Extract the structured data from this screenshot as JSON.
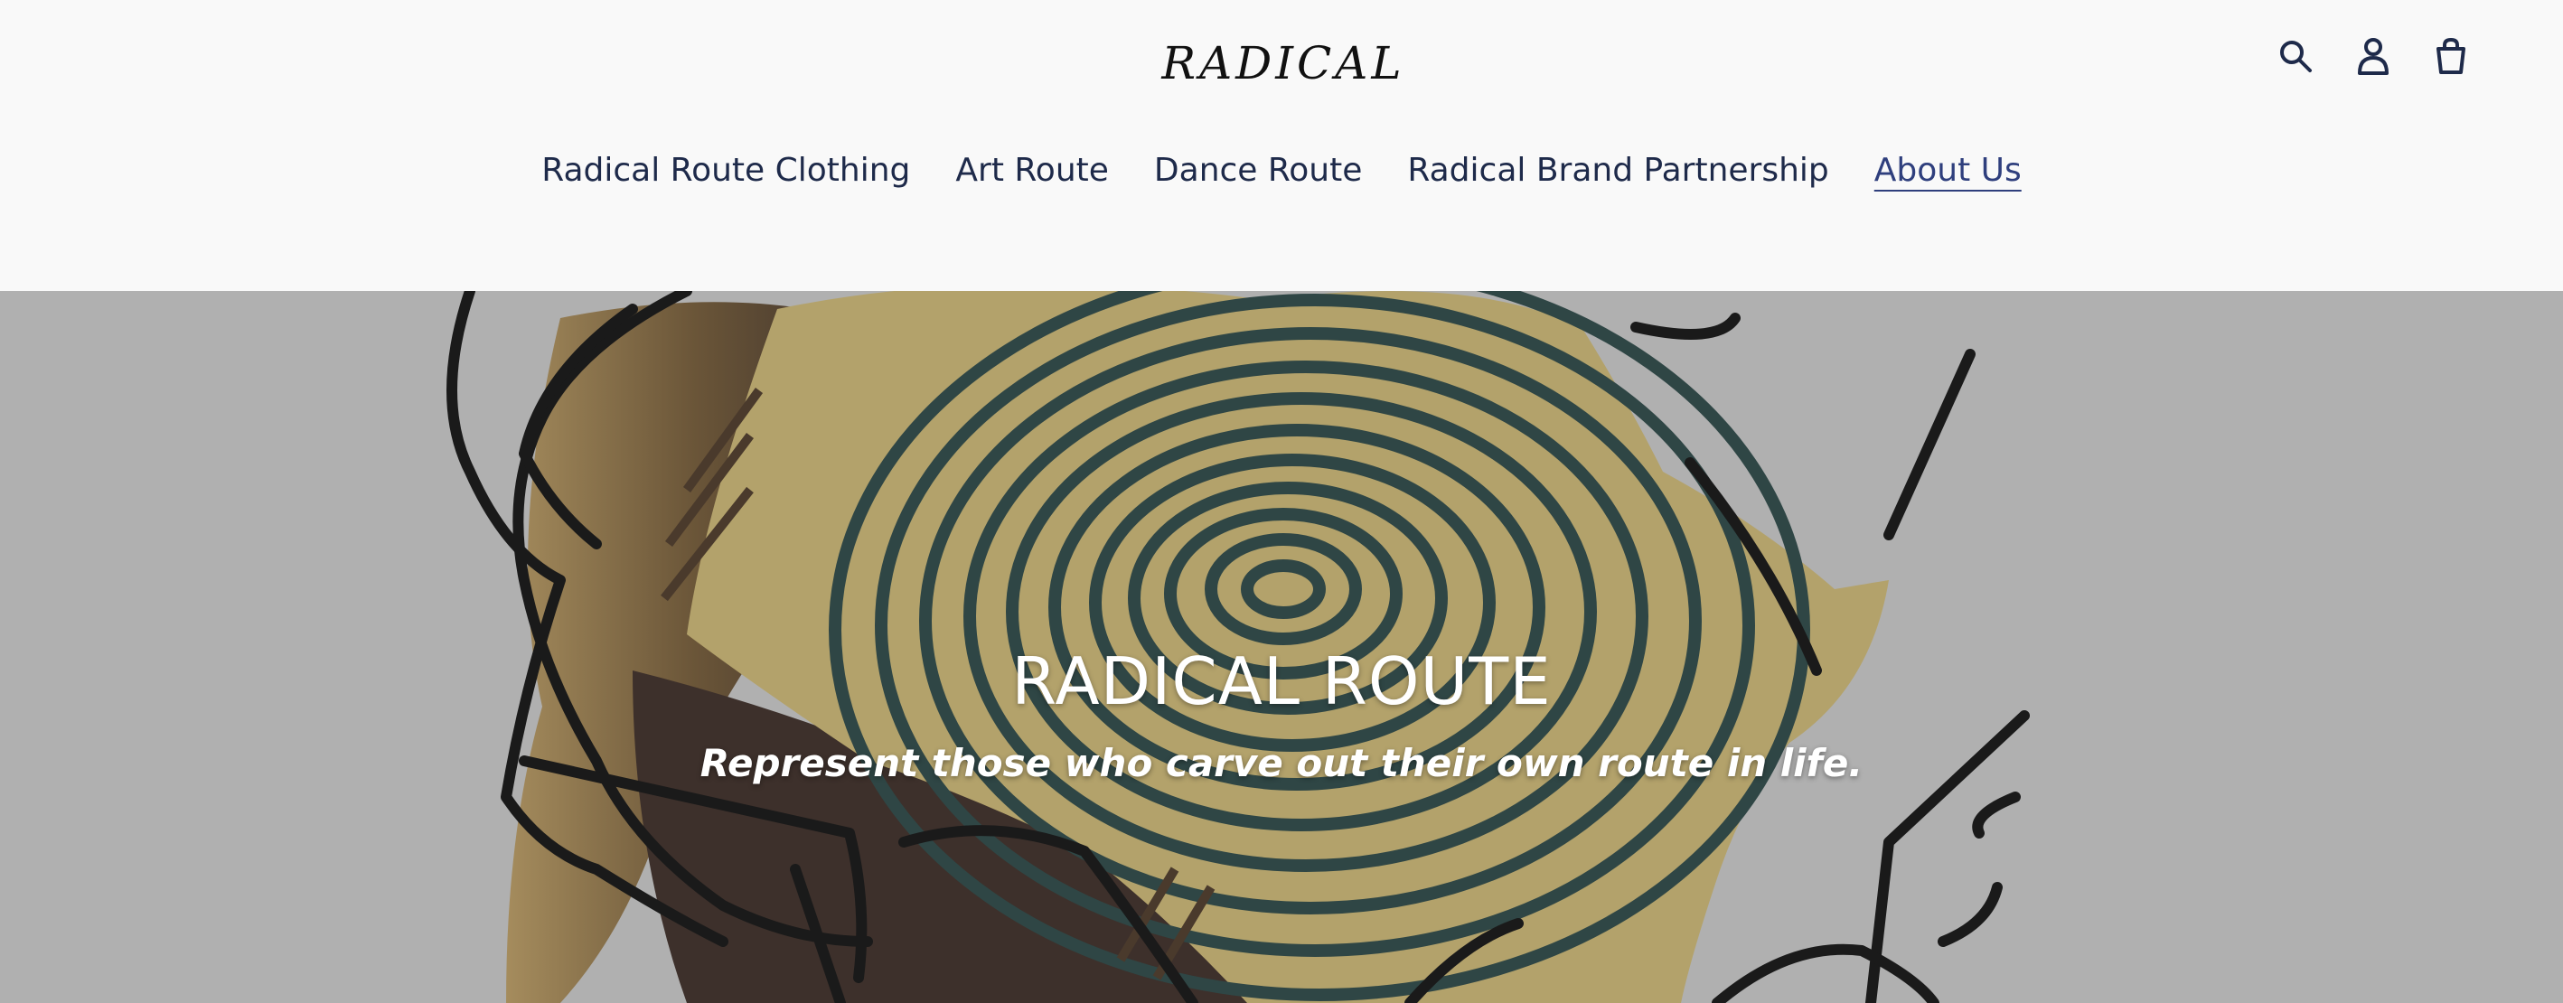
{
  "brand": {
    "logo_text": "RADICAL",
    "icon": "raised-fist-icon"
  },
  "header": {
    "icons": [
      "search-icon",
      "account-icon",
      "cart-icon"
    ]
  },
  "nav": {
    "items": [
      {
        "label": "Radical Route Clothing",
        "active": false
      },
      {
        "label": "Art Route",
        "active": false
      },
      {
        "label": "Dance Route",
        "active": false
      },
      {
        "label": "Radical Brand Partnership",
        "active": false
      },
      {
        "label": "About Us",
        "active": true
      }
    ]
  },
  "hero": {
    "title": "RADICAL ROUTE",
    "subtitle": "Represent those who carve out their own route in life."
  },
  "colors": {
    "nav_text": "#1e2a4a",
    "nav_active": "#2f3f7d",
    "hero_bg": "#b0b0b0",
    "fingerprint_gold": "#b3a26b",
    "fingerprint_dark": "#2f4645",
    "line_black": "#1a1a1a"
  }
}
